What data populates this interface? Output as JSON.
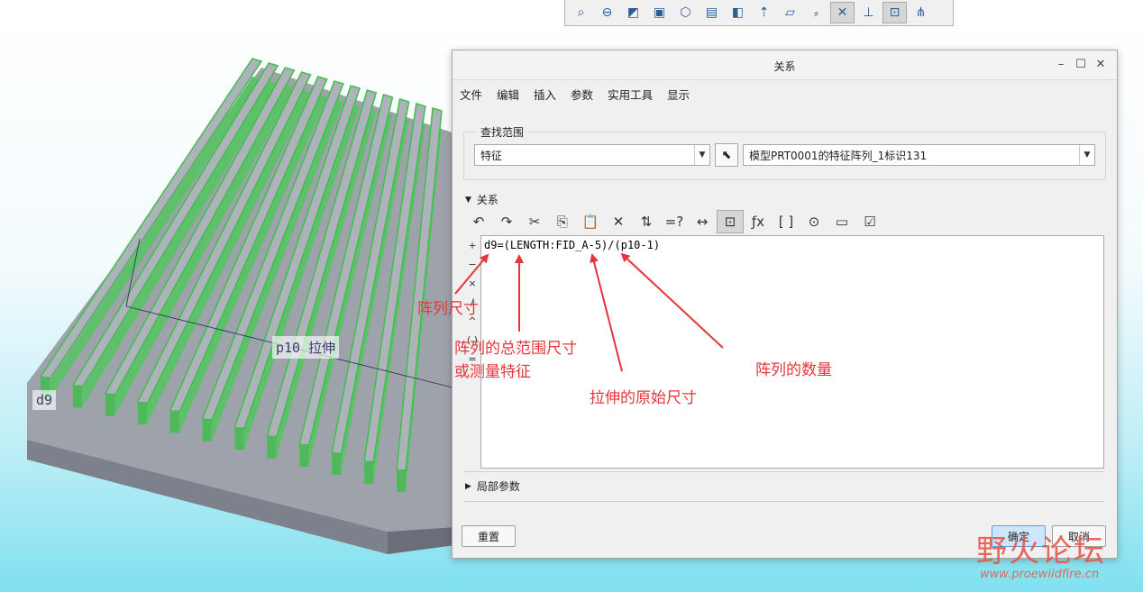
{
  "toolbar_top": {
    "icons": [
      "zoom-in-icon",
      "zoom-out-icon",
      "refit-icon",
      "view-box-icon",
      "saved-views-icon",
      "display-style-icon",
      "datum-plane-icon",
      "datum-axis-icon",
      "datum-point-icon",
      "csys-icon",
      "spin-center-icon",
      "annotation-icon",
      "sketch-icon",
      "appearance-icon"
    ]
  },
  "dialog": {
    "title": "关系",
    "menu": [
      "文件",
      "编辑",
      "插入",
      "参数",
      "实用工具",
      "显示"
    ],
    "lookup": {
      "legend": "查找范围",
      "type_value": "特征",
      "target_value": "模型PRT0001的特征阵列_1标识131"
    },
    "relations": {
      "header": "关系",
      "side_buttons": [
        "+",
        "−",
        "×",
        "/",
        "^",
        "( )",
        "="
      ],
      "code": "d9=(LENGTH:FID_A-5)/(p10-1)"
    },
    "local_params": {
      "header": "局部参数"
    },
    "buttons": {
      "reset": "重置",
      "ok": "确定",
      "cancel": "取消"
    }
  },
  "model": {
    "labels": {
      "p10": "p10 拉伸",
      "d9": "d9"
    }
  },
  "annotations": {
    "a1": "阵列尺寸",
    "a2_line1": "阵列的总范围尺寸",
    "a2_line2": "或测量特征",
    "a3": "拉伸的原始尺寸",
    "a4": "阵列的数量",
    "color": "#e5353a"
  },
  "watermark": {
    "main": "野火论坛",
    "url": "www.proewildfire.cn"
  }
}
